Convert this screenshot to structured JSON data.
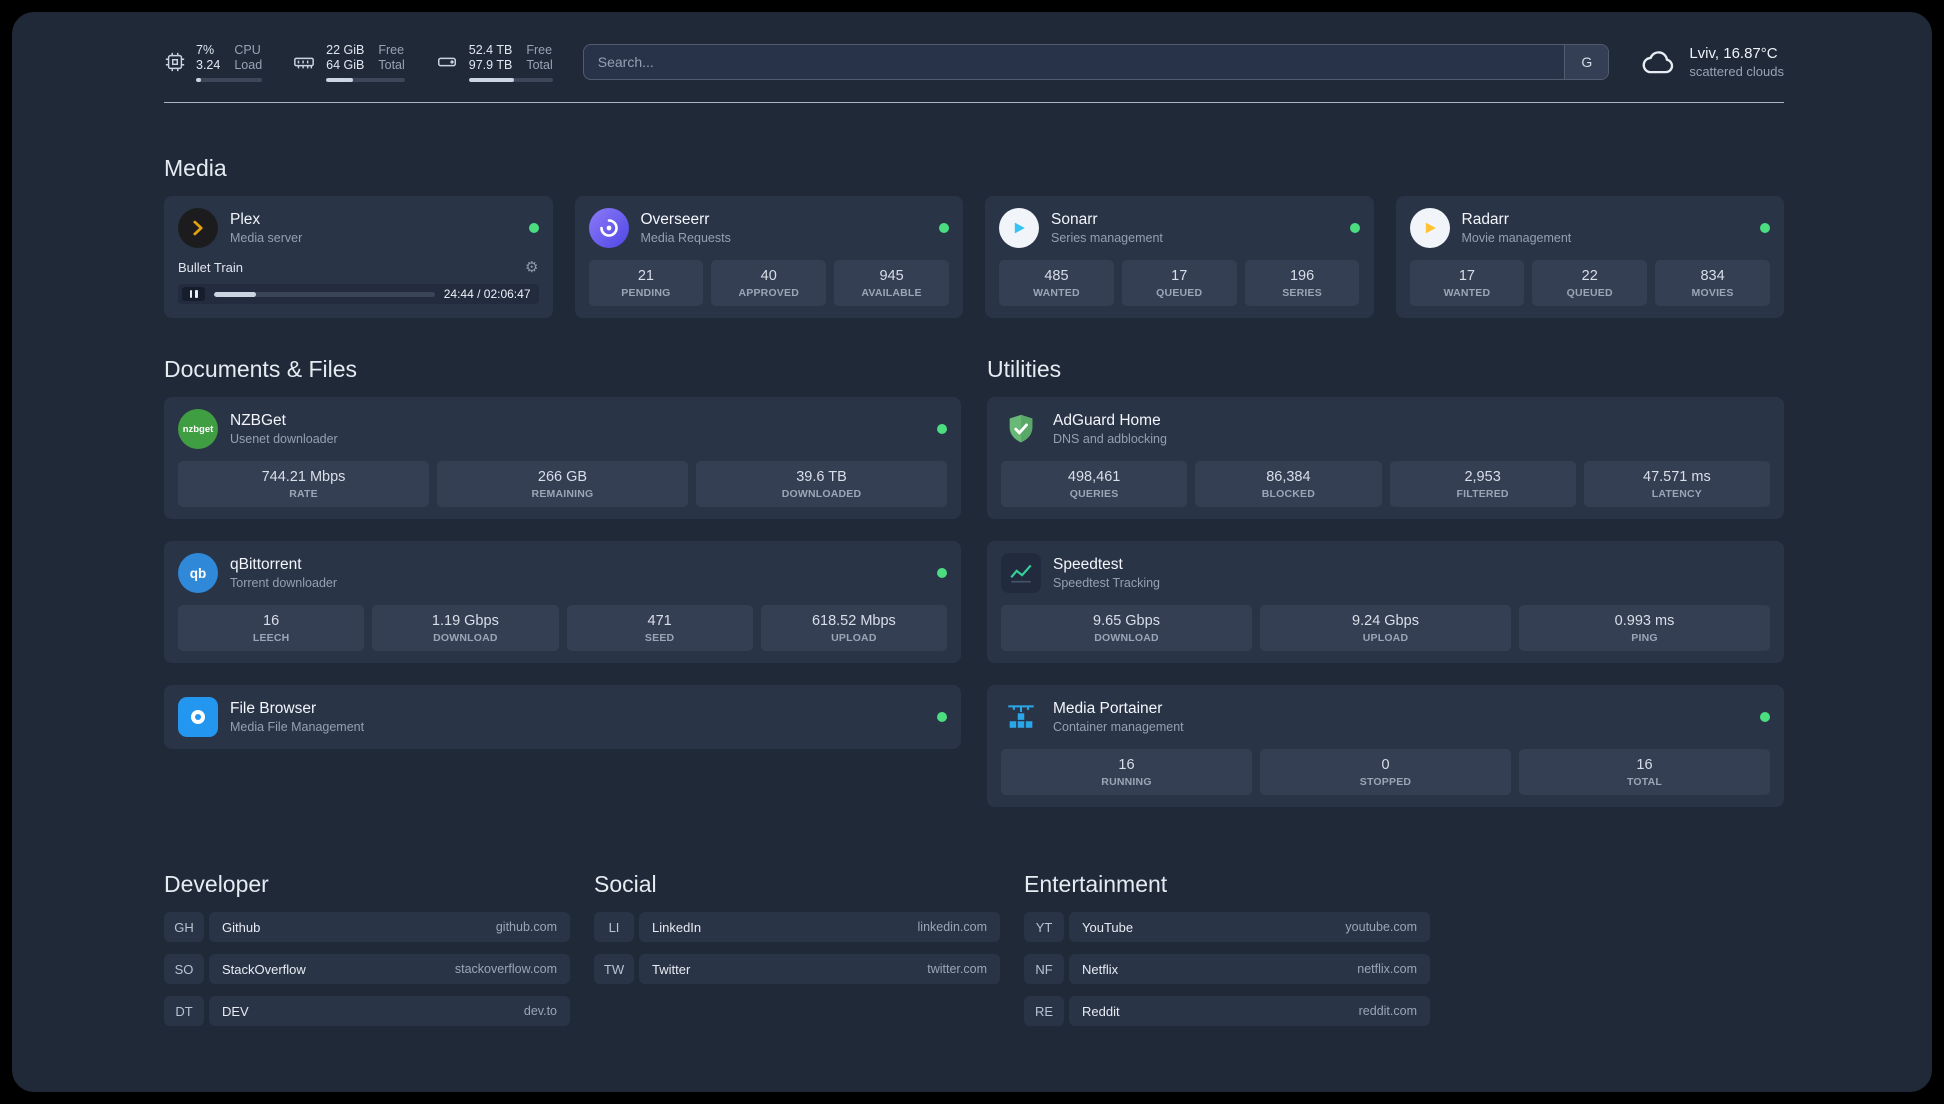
{
  "topbar": {
    "resources": [
      {
        "name": "cpu",
        "line1": "7%",
        "line2": "3.24",
        "label1": "CPU",
        "label2": "Load",
        "percent": 7
      },
      {
        "name": "memory",
        "line1": "22 GiB",
        "line2": "64 GiB",
        "label1": "Free",
        "label2": "Total",
        "percent": 34
      },
      {
        "name": "disk",
        "line1": "52.4 TB",
        "line2": "97.9 TB",
        "label1": "Free",
        "label2": "Total",
        "percent": 54
      }
    ],
    "search": {
      "placeholder": "Search...",
      "provider_label": "G"
    },
    "weather": {
      "location": "Lviv, 16.87°C",
      "condition": "scattered clouds"
    }
  },
  "sections": {
    "media": {
      "title": "Media",
      "plex": {
        "name": "Plex",
        "description": "Media server",
        "status": "online",
        "now_playing": {
          "title": "Bullet Train",
          "time": "24:44 / 02:06:47",
          "progress_percent": 19
        }
      },
      "overseerr": {
        "name": "Overseerr",
        "description": "Media Requests",
        "status": "online",
        "stats": [
          {
            "value": "21",
            "label": "PENDING"
          },
          {
            "value": "40",
            "label": "APPROVED"
          },
          {
            "value": "945",
            "label": "AVAILABLE"
          }
        ]
      },
      "sonarr": {
        "name": "Sonarr",
        "description": "Series management",
        "status": "online",
        "stats": [
          {
            "value": "485",
            "label": "WANTED"
          },
          {
            "value": "17",
            "label": "QUEUED"
          },
          {
            "value": "196",
            "label": "SERIES"
          }
        ]
      },
      "radarr": {
        "name": "Radarr",
        "description": "Movie management",
        "status": "online",
        "stats": [
          {
            "value": "17",
            "label": "WANTED"
          },
          {
            "value": "22",
            "label": "QUEUED"
          },
          {
            "value": "834",
            "label": "MOVIES"
          }
        ]
      }
    },
    "documents": {
      "title": "Documents & Files",
      "nzbget": {
        "name": "NZBGet",
        "description": "Usenet downloader",
        "logo_text": "nzbget",
        "status": "online",
        "stats": [
          {
            "value": "744.21 Mbps",
            "label": "RATE"
          },
          {
            "value": "266 GB",
            "label": "REMAINING"
          },
          {
            "value": "39.6 TB",
            "label": "DOWNLOADED"
          }
        ]
      },
      "qbittorrent": {
        "name": "qBittorrent",
        "description": "Torrent downloader",
        "logo_text": "qb",
        "status": "online",
        "stats": [
          {
            "value": "16",
            "label": "LEECH"
          },
          {
            "value": "1.19 Gbps",
            "label": "DOWNLOAD"
          },
          {
            "value": "471",
            "label": "SEED"
          },
          {
            "value": "618.52 Mbps",
            "label": "UPLOAD"
          }
        ]
      },
      "filebrowser": {
        "name": "File Browser",
        "description": "Media File Management",
        "status": "online"
      }
    },
    "utilities": {
      "title": "Utilities",
      "adguard": {
        "name": "AdGuard Home",
        "description": "DNS and adblocking",
        "stats": [
          {
            "value": "498,461",
            "label": "QUERIES"
          },
          {
            "value": "86,384",
            "label": "BLOCKED"
          },
          {
            "value": "2,953",
            "label": "FILTERED"
          },
          {
            "value": "47.571 ms",
            "label": "LATENCY"
          }
        ]
      },
      "speedtest": {
        "name": "Speedtest",
        "description": "Speedtest Tracking",
        "stats": [
          {
            "value": "9.65 Gbps",
            "label": "DOWNLOAD"
          },
          {
            "value": "9.24 Gbps",
            "label": "UPLOAD"
          },
          {
            "value": "0.993 ms",
            "label": "PING"
          }
        ]
      },
      "portainer": {
        "name": "Media Portainer",
        "description": "Container management",
        "status": "online",
        "stats": [
          {
            "value": "16",
            "label": "RUNNING"
          },
          {
            "value": "0",
            "label": "STOPPED"
          },
          {
            "value": "16",
            "label": "TOTAL"
          }
        ]
      }
    }
  },
  "bookmarks": [
    {
      "title": "Developer",
      "items": [
        {
          "abbr": "GH",
          "name": "Github",
          "url": "github.com"
        },
        {
          "abbr": "SO",
          "name": "StackOverflow",
          "url": "stackoverflow.com"
        },
        {
          "abbr": "DT",
          "name": "DEV",
          "url": "dev.to"
        }
      ]
    },
    {
      "title": "Social",
      "items": [
        {
          "abbr": "LI",
          "name": "LinkedIn",
          "url": "linkedin.com"
        },
        {
          "abbr": "TW",
          "name": "Twitter",
          "url": "twitter.com"
        }
      ]
    },
    {
      "title": "Entertainment",
      "items": [
        {
          "abbr": "YT",
          "name": "YouTube",
          "url": "youtube.com"
        },
        {
          "abbr": "NF",
          "name": "Netflix",
          "url": "netflix.com"
        },
        {
          "abbr": "RE",
          "name": "Reddit",
          "url": "reddit.com"
        }
      ]
    }
  ],
  "colors": {
    "status_online": "#4ade80",
    "plex": "#e5a00d",
    "overseerr": "#6d5cf5",
    "sonarr": "#35c5f4",
    "radarr": "#ffc230",
    "nzbget": "#3f9e42",
    "qbittorrent": "#2f88d8",
    "filebrowser": "#2396ef",
    "adguard": "#68b978",
    "speedtest": "#34d399",
    "portainer": "#2aa7e8"
  }
}
